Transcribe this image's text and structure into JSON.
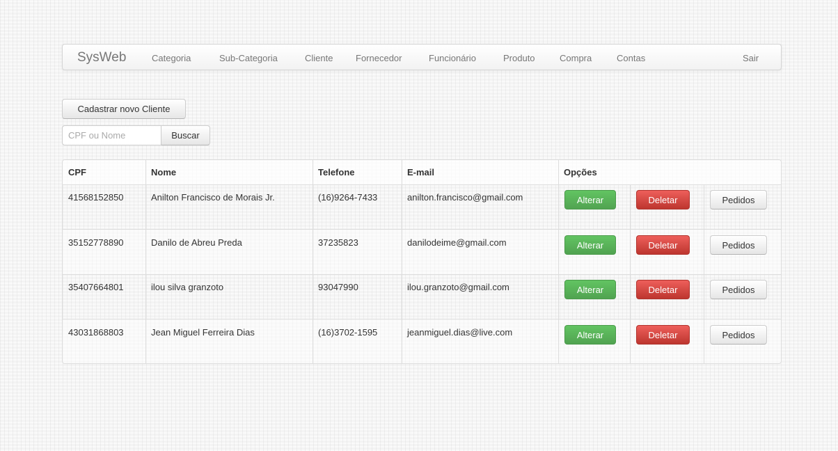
{
  "navbar": {
    "brand": "SysWeb",
    "items": [
      "Categoria",
      "Sub-Categoria",
      "Cliente",
      "Fornecedor",
      "Funcionário",
      "Produto",
      "Compra",
      "Contas"
    ],
    "logout": "Sair"
  },
  "actions": {
    "new_client": "Cadastrar novo Cliente",
    "search_placeholder": "CPF ou Nome",
    "search_button": "Buscar"
  },
  "table": {
    "headers": [
      "CPF",
      "Nome",
      "Telefone",
      "E-mail",
      "Opções"
    ],
    "rows": [
      {
        "cpf": "41568152850",
        "nome": "Anilton Francisco de Morais Jr.",
        "telefone": "(16)9264-7433",
        "email": "anilton.francisco@gmail.com"
      },
      {
        "cpf": "35152778890",
        "nome": "Danilo de Abreu Preda",
        "telefone": "37235823",
        "email": "danilodeime@gmail.com"
      },
      {
        "cpf": "35407664801",
        "nome": "ilou silva granzoto",
        "telefone": "93047990",
        "email": "ilou.granzoto@gmail.com"
      },
      {
        "cpf": "43031868803",
        "nome": "Jean Miguel Ferreira Dias",
        "telefone": "(16)3702-1595",
        "email": "jeanmiguel.dias@live.com"
      }
    ],
    "row_buttons": {
      "edit": "Alterar",
      "delete": "Deletar",
      "orders": "Pedidos"
    }
  },
  "colors": {
    "success": "#5bb75b",
    "danger": "#da4f49",
    "navbar_text": "#777777"
  }
}
